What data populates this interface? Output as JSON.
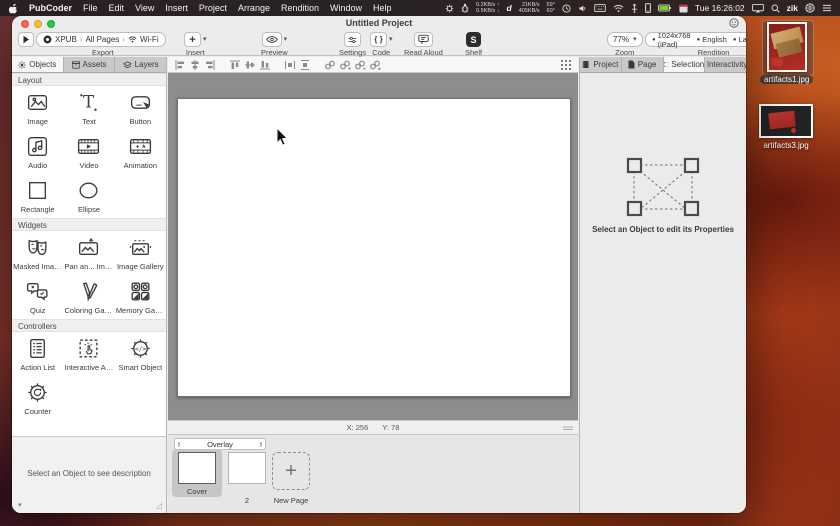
{
  "colors": {
    "traffic_red": "#ff5f57",
    "traffic_yellow": "#febc2e",
    "traffic_green": "#28c840",
    "battery_green": "#7ed321",
    "selection_gray": "#c6c6c6",
    "canvas_gray": "#8d8d8f"
  },
  "menubar": {
    "app": "PubCoder",
    "items": [
      "File",
      "Edit",
      "View",
      "Insert",
      "Project",
      "Arrange",
      "Rendition",
      "Window",
      "Help"
    ],
    "net1_up": "0.2KB/s ↑",
    "net1_down": "0.5KB/s ↓",
    "docker_letter": "d",
    "net2_up": "21KB/s",
    "net2_down": "405KB/s",
    "temp_up": "59°",
    "temp_down": "60°",
    "clock": "Tue 16:26:02",
    "user": "zik"
  },
  "window": {
    "title": "Untitled Project",
    "toolbar": {
      "export_label": "Export",
      "export_crumb1": "XPUB",
      "export_sep1": "›",
      "export_crumb2": "All Pages",
      "export_sep2": "›",
      "export_crumb3": "Wi-Fi",
      "insert_label": "Insert",
      "insert_glyph": "+",
      "preview_label": "Preview",
      "settings_label": "Settings",
      "code_label": "Code",
      "code_glyph": "{ }",
      "read_aloud_label": "Read Aloud",
      "shelf_label": "Shelf",
      "shelf_glyph": "S",
      "zoom_label": "Zoom",
      "zoom_value": "77%",
      "rendition_label": "Rendition",
      "rendition_size": "1024x768 (iPad)",
      "rendition_lang": "English",
      "rendition_orient": "Landscape",
      "marker": "●"
    },
    "sidebar": {
      "tabs": [
        "Objects",
        "Assets",
        "Layers"
      ],
      "layout_title": "Layout",
      "widgets_title": "Widgets",
      "controllers_title": "Controllers",
      "layout_items": [
        "Image",
        "Text",
        "Button",
        "Audio",
        "Video",
        "Animation",
        "Rectangle",
        "Ellipse"
      ],
      "widget_items": [
        "Masked Image",
        "Pan an... Image",
        "Image Gallery",
        "Quiz",
        "Coloring Game",
        "Memory Game"
      ],
      "controller_items": [
        "Action List",
        "Interactive Area",
        "Smart Object",
        "Counter"
      ],
      "description_placeholder": "Select an Object to see description"
    },
    "statusbar": {
      "x": "X: 256",
      "y": "Y: 78"
    },
    "pages": {
      "overlay": "Overlay",
      "items": [
        "Cover",
        "2",
        "New Page"
      ],
      "new_page_glyph": "+"
    },
    "inspector": {
      "tabs": [
        "Project",
        "Page",
        "Selection",
        "Interactivity"
      ],
      "active_tab": "Selection",
      "placeholder": "Select an Object to edit its Properties"
    }
  },
  "desktop": {
    "icons": [
      "artifacts1.jpg",
      "artifacts3.jpg"
    ]
  }
}
